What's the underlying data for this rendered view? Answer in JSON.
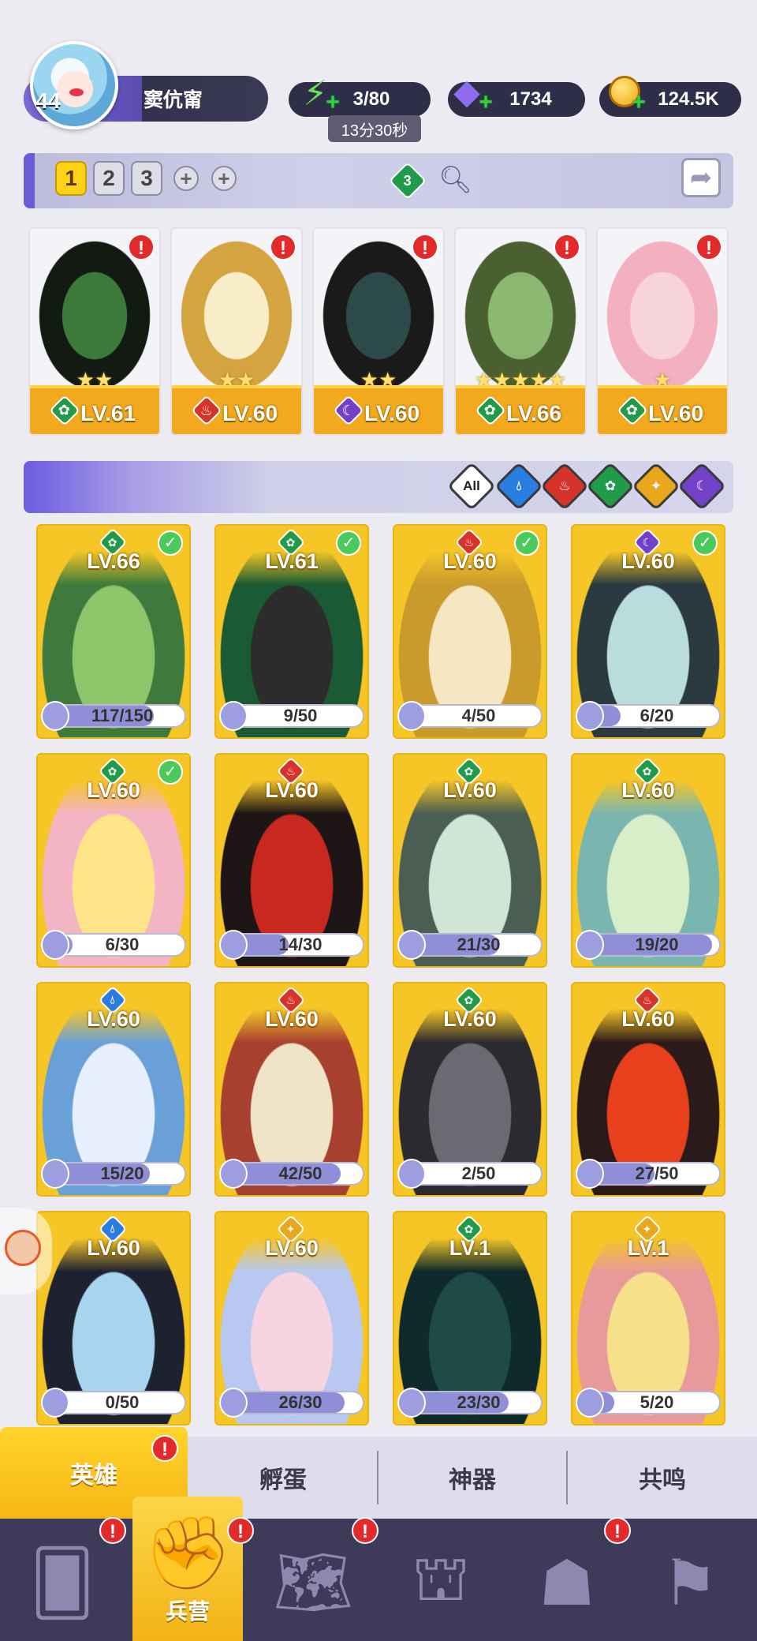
{
  "player": {
    "level": "44",
    "name": "窦伉甯"
  },
  "resources": {
    "energy": {
      "value": "3/80",
      "timer": "13分30秒",
      "icon": "lightning-icon"
    },
    "gems": {
      "value": "1734",
      "icon": "diamond-icon"
    },
    "coins": {
      "value": "124.5K",
      "icon": "coin-icon"
    }
  },
  "team_bar": {
    "slots": [
      "1",
      "2",
      "3"
    ],
    "active_slot": "1",
    "add_symbol": "+",
    "element_badge": "3",
    "alert_symbol": "!"
  },
  "team": [
    {
      "level": "LV.61",
      "element": "nature",
      "stars": "★★"
    },
    {
      "level": "LV.60",
      "element": "fire",
      "stars": "★★"
    },
    {
      "level": "LV.60",
      "element": "dark",
      "stars": "★★"
    },
    {
      "level": "LV.66",
      "element": "nature",
      "stars": "★★★★★"
    },
    {
      "level": "LV.60",
      "element": "nature",
      "stars": "★"
    }
  ],
  "filter": {
    "all_label": "All",
    "elements": [
      "water",
      "fire",
      "nature",
      "light",
      "dark"
    ]
  },
  "heroes": [
    {
      "level": "LV.66",
      "element": "nature",
      "progress": "117/150",
      "fraction": 0.78,
      "owned_check": true,
      "palette": [
        "#8fc56a",
        "#3f7a3c"
      ]
    },
    {
      "level": "LV.61",
      "element": "nature",
      "progress": "9/50",
      "fraction": 0.18,
      "owned_check": true,
      "palette": [
        "#2c2c2c",
        "#1a5a34"
      ]
    },
    {
      "level": "LV.60",
      "element": "fire",
      "progress": "4/50",
      "fraction": 0.08,
      "owned_check": true,
      "palette": [
        "#f5e7c2",
        "#c99a2c"
      ]
    },
    {
      "level": "LV.60",
      "element": "dark",
      "progress": "6/20",
      "fraction": 0.3,
      "owned_check": true,
      "palette": [
        "#b9dcdc",
        "#2a3a40"
      ]
    },
    {
      "level": "LV.60",
      "element": "nature",
      "progress": "6/30",
      "fraction": 0.2,
      "owned_check": true,
      "palette": [
        "#ffe58a",
        "#f3b4c4"
      ]
    },
    {
      "level": "LV.60",
      "element": "fire",
      "progress": "14/30",
      "fraction": 0.47,
      "owned_check": false,
      "palette": [
        "#c8281e",
        "#1e1616"
      ]
    },
    {
      "level": "LV.60",
      "element": "nature",
      "progress": "21/30",
      "fraction": 0.7,
      "owned_check": false,
      "palette": [
        "#cfe6d6",
        "#4a5e52"
      ]
    },
    {
      "level": "LV.60",
      "element": "nature",
      "progress": "19/20",
      "fraction": 0.95,
      "owned_check": false,
      "palette": [
        "#d8eec8",
        "#7ab6b0"
      ]
    },
    {
      "level": "LV.60",
      "element": "water",
      "progress": "15/20",
      "fraction": 0.75,
      "owned_check": false,
      "palette": [
        "#e8f0ff",
        "#6aa0d8"
      ]
    },
    {
      "level": "LV.60",
      "element": "fire",
      "progress": "42/50",
      "fraction": 0.84,
      "owned_check": false,
      "palette": [
        "#efe4c8",
        "#a84030"
      ]
    },
    {
      "level": "LV.60",
      "element": "nature",
      "progress": "2/50",
      "fraction": 0.04,
      "owned_check": false,
      "palette": [
        "#6a6a72",
        "#2a2a30"
      ]
    },
    {
      "level": "LV.60",
      "element": "fire",
      "progress": "27/50",
      "fraction": 0.54,
      "owned_check": false,
      "palette": [
        "#e8401c",
        "#2a1a1a"
      ]
    },
    {
      "level": "LV.60",
      "element": "water",
      "progress": "0/50",
      "fraction": 0.0,
      "owned_check": false,
      "palette": [
        "#a8d4f0",
        "#1e2230"
      ]
    },
    {
      "level": "LV.60",
      "element": "light",
      "progress": "26/30",
      "fraction": 0.87,
      "owned_check": false,
      "palette": [
        "#f6d4e0",
        "#b8c8f0"
      ]
    },
    {
      "level": "LV.1",
      "element": "nature",
      "progress": "23/30",
      "fraction": 0.77,
      "owned_check": false,
      "palette": [
        "#1e4a48",
        "#0e2a2a"
      ]
    },
    {
      "level": "LV.1",
      "element": "light",
      "progress": "5/20",
      "fraction": 0.25,
      "owned_check": false,
      "palette": [
        "#f7e08a",
        "#e89a9a"
      ]
    }
  ],
  "tabs": [
    {
      "label": "英雄",
      "active": true,
      "alert": true
    },
    {
      "label": "孵蛋",
      "active": false,
      "alert": false
    },
    {
      "label": "神器",
      "active": false,
      "alert": false
    },
    {
      "label": "共鸣",
      "active": false,
      "alert": false
    }
  ],
  "nav": [
    {
      "icon": "cards-icon",
      "label": "",
      "alert": true
    },
    {
      "icon": "barracks-icon",
      "label": "兵营",
      "alert": true,
      "active": true
    },
    {
      "icon": "map-icon",
      "label": "",
      "alert": true
    },
    {
      "icon": "castle-icon",
      "label": "",
      "alert": false
    },
    {
      "icon": "mushroom-icon",
      "label": "",
      "alert": true
    },
    {
      "icon": "guild-banner-icon",
      "label": "",
      "alert": false
    }
  ],
  "colors": {
    "accent_purple": "#6a5cd6",
    "gold": "#f5c626",
    "nature": "#1f9b4a",
    "fire": "#d8332a",
    "dark": "#7340c8",
    "water": "#2a7de0",
    "light": "#e8a71c"
  }
}
